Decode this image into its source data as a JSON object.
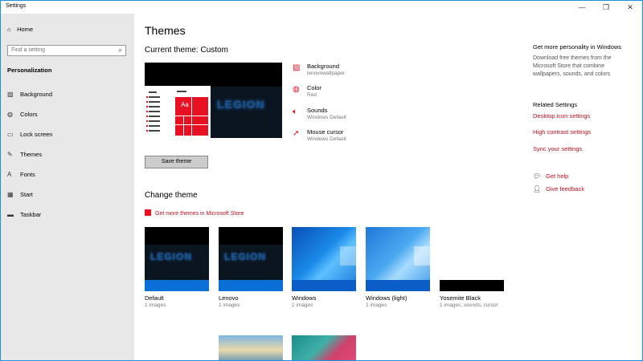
{
  "window": {
    "title": "Settings",
    "minimize": "—",
    "maximize": "❐",
    "close": "✕"
  },
  "sidebar": {
    "home_label": "Home",
    "search_placeholder": "Find a setting",
    "section": "Personalization",
    "items": [
      {
        "label": "Background",
        "icon": "picture-icon"
      },
      {
        "label": "Colors",
        "icon": "palette-icon"
      },
      {
        "label": "Lock screen",
        "icon": "lock-screen-icon"
      },
      {
        "label": "Themes",
        "icon": "brush-icon"
      },
      {
        "label": "Fonts",
        "icon": "font-icon"
      },
      {
        "label": "Start",
        "icon": "start-icon"
      },
      {
        "label": "Taskbar",
        "icon": "taskbar-icon"
      }
    ]
  },
  "main": {
    "title": "Themes",
    "current_theme_heading": "Current theme: Custom",
    "preview_text": "LEGION",
    "preview_tile_text": "Aa",
    "properties": [
      {
        "title": "Background",
        "value": "lenovowallpaper",
        "icon": "picture-icon"
      },
      {
        "title": "Color",
        "value": "Red",
        "icon": "palette-icon"
      },
      {
        "title": "Sounds",
        "value": "Windows Default",
        "icon": "speaker-icon"
      },
      {
        "title": "Mouse cursor",
        "value": "Windows Default",
        "icon": "cursor-icon"
      }
    ],
    "save_button": "Save theme",
    "change_theme_heading": "Change theme",
    "store_link": "Get more themes in Microsoft Store",
    "themes": [
      {
        "name": "Default",
        "sub": "1 images"
      },
      {
        "name": "Lenovo",
        "sub": "1 images"
      },
      {
        "name": "Windows",
        "sub": "1 images"
      },
      {
        "name": "Windows (light)",
        "sub": "1 images"
      },
      {
        "name": "Yosemite Black",
        "sub": "1 images, sounds, cursor"
      }
    ]
  },
  "right": {
    "personality_title": "Get more personality in Windows",
    "personality_desc": "Download free themes from the Microsoft Store that combine wallpapers, sounds, and colors",
    "related_title": "Related Settings",
    "related_links": [
      "Desktop icon settings",
      "High contrast settings",
      "Sync your settings"
    ],
    "help_link": "Get help",
    "feedback_link": "Give feedback"
  },
  "colors": {
    "accent": "#e81123",
    "link": "#c20f1e",
    "sidebar_bg": "#e8e8e8",
    "window_border": "#1e90e0"
  }
}
